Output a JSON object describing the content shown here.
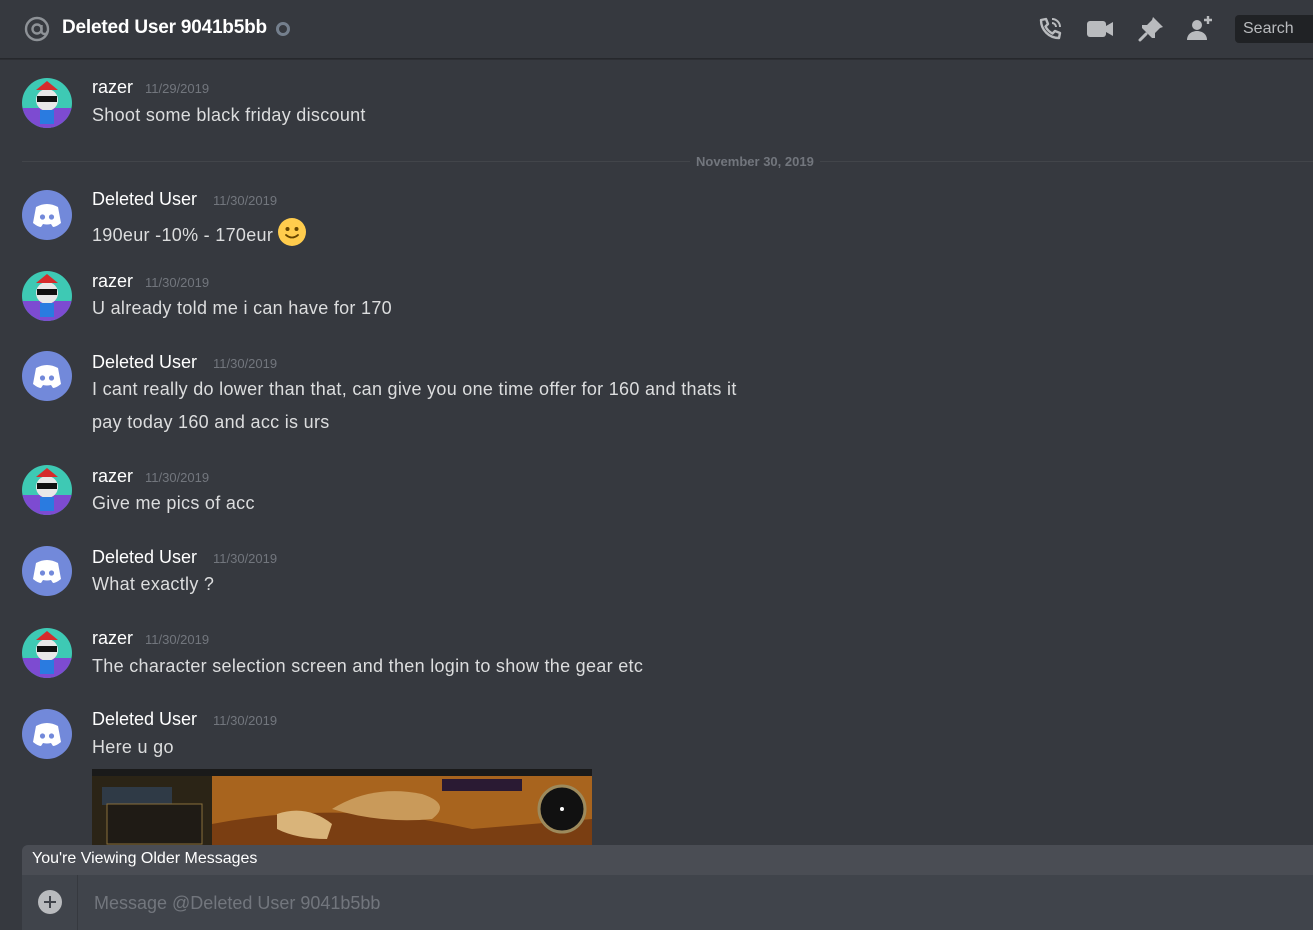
{
  "header": {
    "title": "Deleted User 9041b5bb",
    "icons": [
      "at-icon",
      "status-offline-icon",
      "call-icon",
      "video-icon",
      "pin-icon",
      "add-friend-icon"
    ],
    "search_placeholder": "Search"
  },
  "messages": [
    {
      "author": "razer",
      "timestamp": "11/29/2019",
      "lines": [
        "Shoot some black friday discount"
      ]
    },
    {
      "author": "Deleted User",
      "timestamp": "11/30/2019",
      "lines": [
        "190eur -10% - 170eur"
      ],
      "emoji": "slightly-smiling-face-icon"
    },
    {
      "author": "razer",
      "timestamp": "11/30/2019",
      "lines": [
        "U already told me i can have for 170"
      ]
    },
    {
      "author": "Deleted User",
      "timestamp": "11/30/2019",
      "lines": [
        "I cant really do lower than that, can give you one time offer for 160 and thats it",
        "pay today 160 and acc is urs"
      ]
    },
    {
      "author": "razer",
      "timestamp": "11/30/2019",
      "lines": [
        "Give me pics of acc"
      ]
    },
    {
      "author": "Deleted User",
      "timestamp": "11/30/2019",
      "lines": [
        "What exactly ?"
      ]
    },
    {
      "author": "razer",
      "timestamp": "11/30/2019",
      "lines": [
        "The character selection screen and then login to show the gear etc"
      ]
    },
    {
      "author": "Deleted User",
      "timestamp": "11/30/2019",
      "lines": [
        "Here u go"
      ],
      "attachment": "game-screenshot-image"
    }
  ],
  "date_divider": "November 30, 2019",
  "older_messages_notice": "You're Viewing Older Messages",
  "composer": {
    "placeholder": "Message @Deleted User 9041b5bb"
  },
  "colors": {
    "background": "#36393f",
    "blurple": "#7289da",
    "username": "#ffffff",
    "timestamp": "#72767d",
    "text": "#dcddde"
  }
}
